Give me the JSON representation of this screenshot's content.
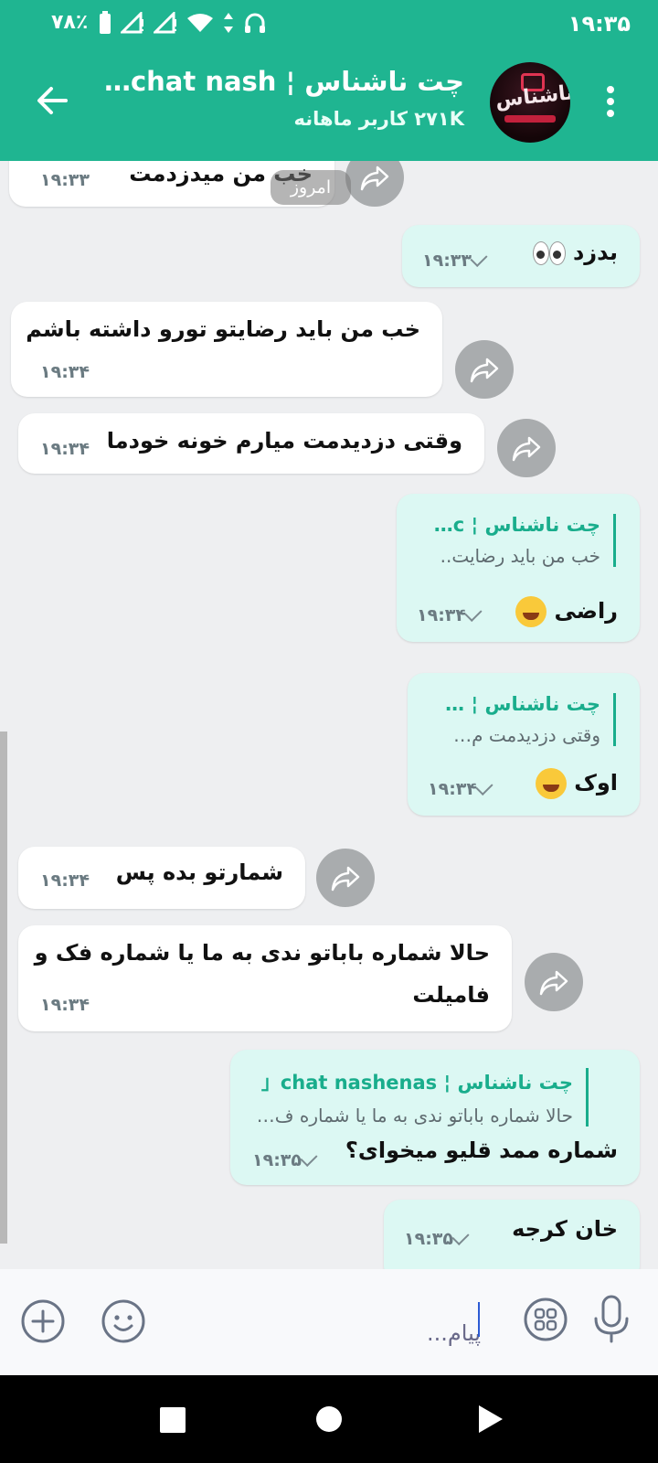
{
  "status_bar": {
    "time": "۱۹:۳۵",
    "battery": "۷۸٪"
  },
  "header": {
    "title": "چت ناشناس ¦ chat nash…",
    "subtitle": "۲۷۱K کاربر ماهانه",
    "avatar_text": "ناشناس"
  },
  "chat": {
    "date_separator": "امروز",
    "messages": [
      {
        "dir": "in",
        "text": "خب من میدزدمت",
        "time": "۱۹:۳۳"
      },
      {
        "dir": "out",
        "text": "بدزد",
        "time": "۱۹:۳۳"
      },
      {
        "dir": "in",
        "text": "خب من باید رضایتو تورو داشته باشم",
        "time": "۱۹:۳۴"
      },
      {
        "dir": "in",
        "text": "وقتی دزدیدمت میارم خونه خودما",
        "time": "۱۹:۳۴"
      },
      {
        "dir": "out",
        "reply_name": "چت ناشناس ¦ c…",
        "reply_text": "خب من باید رضایت..",
        "text": "راضی",
        "time": "۱۹:۳۴"
      },
      {
        "dir": "out",
        "reply_name": "چت ناشناس ¦ …",
        "reply_text": "وقتی دزدیدمت م…",
        "text": "اوک",
        "time": "۱۹:۳۴"
      },
      {
        "dir": "in",
        "text": "شمارتو بده پس",
        "time": "۱۹:۳۴"
      },
      {
        "dir": "in",
        "text_line1": "حالا شماره باباتو ندی به ما یا شماره فک و",
        "text_line2": "فامیلت",
        "time": "۱۹:۳۴"
      },
      {
        "dir": "out",
        "reply_name": "چت ناشناس ¦ chat nashenas「",
        "reply_text": "حالا شماره باباتو ندی به ما یا شماره ف…",
        "text": "شماره ممد قلیو میخوای؟",
        "time": "۱۹:۳۵"
      },
      {
        "dir": "out",
        "text": "خان کرجه",
        "time": "۱۹:۳۵"
      }
    ]
  },
  "input": {
    "placeholder": "پیام..."
  },
  "colors": {
    "accent": "#1fb591",
    "incoming": "#ffffff",
    "outgoing": "#dcf8f3"
  }
}
